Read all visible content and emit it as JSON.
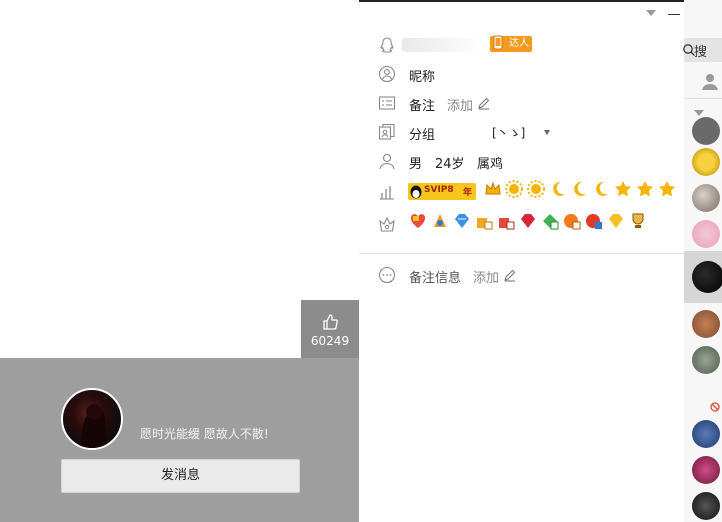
{
  "header": {
    "more_icon": "chevron-down-icon"
  },
  "photo": {
    "likes": "60249",
    "signature": "愿时光能缓 愿故人不散!",
    "send_button": "发消息"
  },
  "profile": {
    "talent_badge": "达人",
    "nickname_label": "昵称",
    "remark_label": "备注",
    "remark_add": "添加",
    "group_label": "分组",
    "group_value": "[丶ゝ]",
    "gender": "男",
    "age": "24岁",
    "zodiac": "属鸡",
    "svip_label": "SVIP8",
    "svip_year": "年",
    "remark_info_label": "备注信息",
    "remark_info_add": "添加"
  },
  "side": {
    "search_label": "搜"
  },
  "colors": {
    "card_gray": "#9e9e9e",
    "like_gray": "#8c8c8c",
    "badge_orange": "#f39a1e",
    "svip_yellow": "#f7c51c"
  }
}
